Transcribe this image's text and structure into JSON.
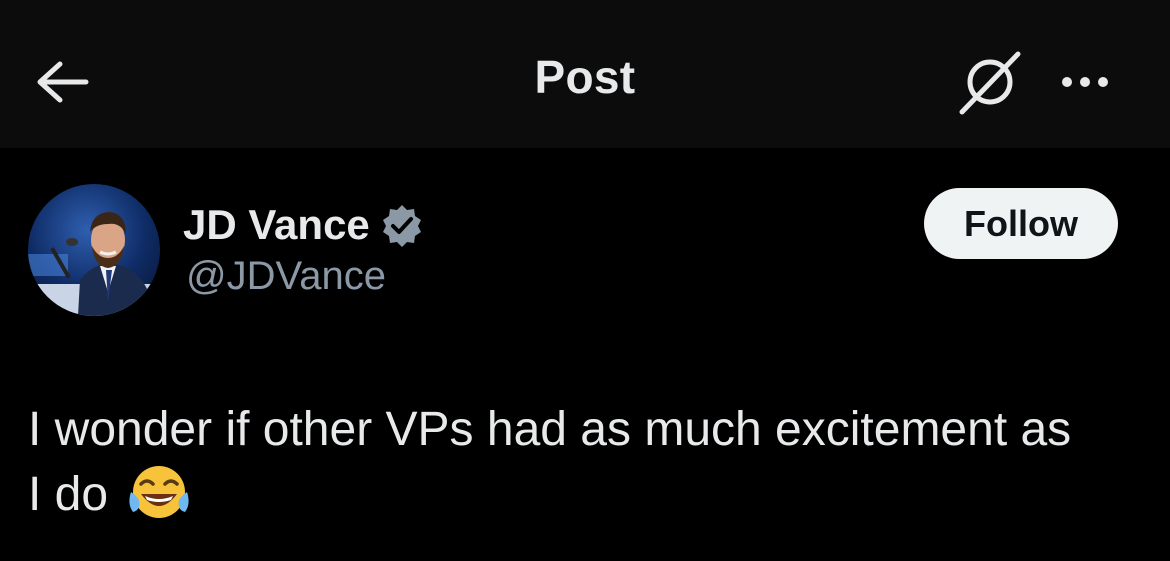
{
  "header": {
    "title": "Post",
    "back_icon": "arrow-left-icon",
    "grok_icon": "grok-icon",
    "more_icon": "more-horizontal-icon"
  },
  "author": {
    "display_name": "JD Vance",
    "handle": "@JDVance",
    "verified": true,
    "verified_color": "#8b98a5"
  },
  "follow_button": {
    "label": "Follow"
  },
  "post": {
    "text_line1": "I wonder if other VPs had as much excitement as",
    "text_line2": "I do",
    "emoji": "face-with-tears-of-joy"
  },
  "colors": {
    "background": "#000000",
    "header_background": "#0c0c0c",
    "primary_text": "#e7e9ea",
    "secondary_text": "#8b98a5"
  }
}
